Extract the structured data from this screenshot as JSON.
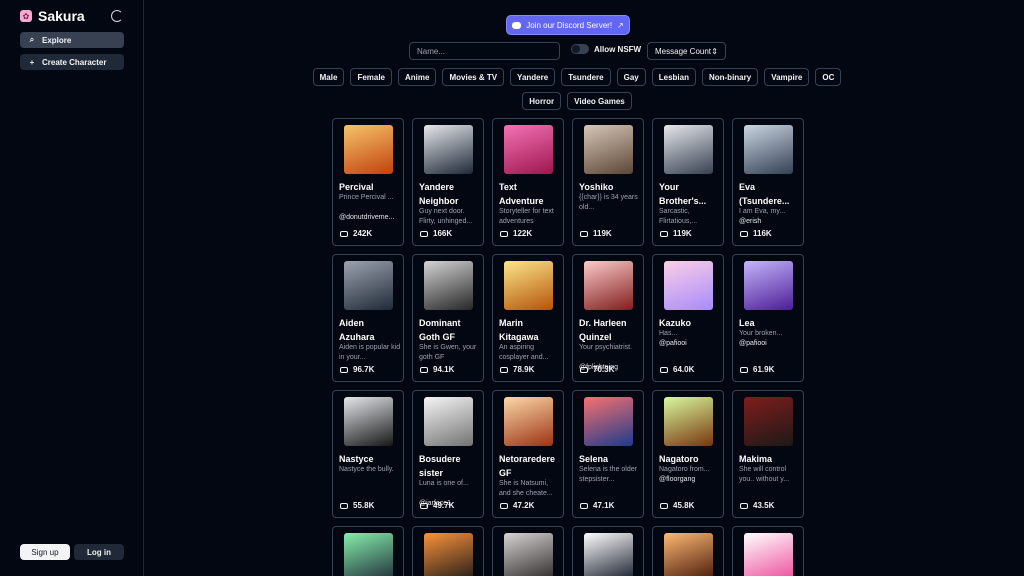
{
  "brand": {
    "name": "Sakura",
    "logo_icon": "sakura-logo-icon"
  },
  "sidebar": {
    "explore_label": "Explore",
    "create_label": "Create Character",
    "signup_label": "Sign up",
    "login_label": "Log in"
  },
  "top": {
    "discord_label": "Join our Discord Server!",
    "search_placeholder": "Name...",
    "nsfw_label": "Allow NSFW",
    "sort_value": "Message Count"
  },
  "tags_row1": [
    "Male",
    "Female",
    "Anime",
    "Movies & TV",
    "Yandere",
    "Tsundere",
    "Gay",
    "Lesbian",
    "Non-binary",
    "Vampire",
    "OC"
  ],
  "tags_row2": [
    "Horror",
    "Video Games"
  ],
  "colors": {
    "accent": "#6366f1",
    "background": "#030712",
    "border": "#374151"
  },
  "cards": [
    {
      "name": "Percival",
      "desc": "Prince Percival ...",
      "author": "@donutdriveme...",
      "count": "242K",
      "grad": [
        "#f5c46b",
        "#c2410c"
      ]
    },
    {
      "name": "Yandere Neighbor",
      "desc": "Guy next door. Flirty, unhinged...",
      "author": "",
      "count": "166K",
      "grad": [
        "#e5e7eb",
        "#1f2937"
      ]
    },
    {
      "name": "Text Adventure",
      "desc": "Storyteller for text adventures",
      "author": "",
      "count": "122K",
      "grad": [
        "#f472b6",
        "#9d174d"
      ]
    },
    {
      "name": "Yoshiko",
      "desc": "{{char}} is 34 years old...",
      "author": "",
      "count": "119K",
      "grad": [
        "#d6c7b8",
        "#5b4636"
      ]
    },
    {
      "name": "Your Brother's...",
      "desc": "Sarcastic, Flirtatious,...",
      "author": "",
      "count": "119K",
      "grad": [
        "#e5e7eb",
        "#374151"
      ]
    },
    {
      "name": "Eva (Tsundere...",
      "desc": "I am Eva, my...",
      "author": "@erish",
      "count": "116K",
      "grad": [
        "#cbd5e1",
        "#334155"
      ]
    },
    {
      "name": "Aiden Azuhara",
      "desc": "Aiden is popular kid in your...",
      "author": "",
      "count": "96.7K",
      "grad": [
        "#9ca3af",
        "#1f2937"
      ]
    },
    {
      "name": "Dominant Goth GF",
      "desc": "She is Gwen, your goth GF",
      "author": "",
      "count": "94.1K",
      "grad": [
        "#d4d4d4",
        "#262626"
      ]
    },
    {
      "name": "Marin Kitagawa",
      "desc": "An aspiring cosplayer and...",
      "author": "",
      "count": "78.9K",
      "grad": [
        "#fde68a",
        "#b45309"
      ]
    },
    {
      "name": "Dr. Harleen Quinzel",
      "desc": "Your psychiatrist.",
      "author": "@fplightning",
      "count": "70.3K",
      "grad": [
        "#fecaca",
        "#7f1d1d"
      ]
    },
    {
      "name": "Kazuko",
      "desc": "Has...",
      "author": "@pafiooi",
      "count": "64.0K",
      "grad": [
        "#fbcfe8",
        "#a78bfa"
      ]
    },
    {
      "name": "Lea",
      "desc": "Your broken...",
      "author": "@pafiooi",
      "count": "61.9K",
      "grad": [
        "#c4b5fd",
        "#4c1d95"
      ]
    },
    {
      "name": "Nastyce",
      "desc": "Nastyce the bully.",
      "author": "",
      "count": "55.8K",
      "grad": [
        "#e5e7eb",
        "#171717"
      ]
    },
    {
      "name": "Bosudere sister",
      "desc": "Luna is one of...",
      "author": "@jarface1",
      "count": "49.7K",
      "grad": [
        "#f5f5f5",
        "#737373"
      ]
    },
    {
      "name": "Netoraredere GF",
      "desc": "She is Natsumi, and she cheate...",
      "author": "",
      "count": "47.2K",
      "grad": [
        "#fed7aa",
        "#9a3412"
      ]
    },
    {
      "name": "Selena",
      "desc": "Selena is the older stepsister...",
      "author": "",
      "count": "47.1K",
      "grad": [
        "#f87171",
        "#1e3a8a"
      ]
    },
    {
      "name": "Nagatoro",
      "desc": "Nagatoro from...",
      "author": "@floorgang",
      "count": "45.8K",
      "grad": [
        "#d9f99d",
        "#78350f"
      ]
    },
    {
      "name": "Makima",
      "desc": "She will control you.. without y...",
      "author": "",
      "count": "43.5K",
      "grad": [
        "#7f1d1d",
        "#1c1917"
      ]
    }
  ],
  "partial_cards": [
    {
      "grad": [
        "#86efac",
        "#1f2937"
      ]
    },
    {
      "grad": [
        "#fb923c",
        "#1c1917"
      ]
    },
    {
      "grad": [
        "#d6d3d1",
        "#292524"
      ]
    },
    {
      "grad": [
        "#ffffff",
        "#111827"
      ]
    },
    {
      "grad": [
        "#fdba74",
        "#431407"
      ]
    },
    {
      "grad": [
        "#ffffff",
        "#ec4899"
      ]
    }
  ]
}
